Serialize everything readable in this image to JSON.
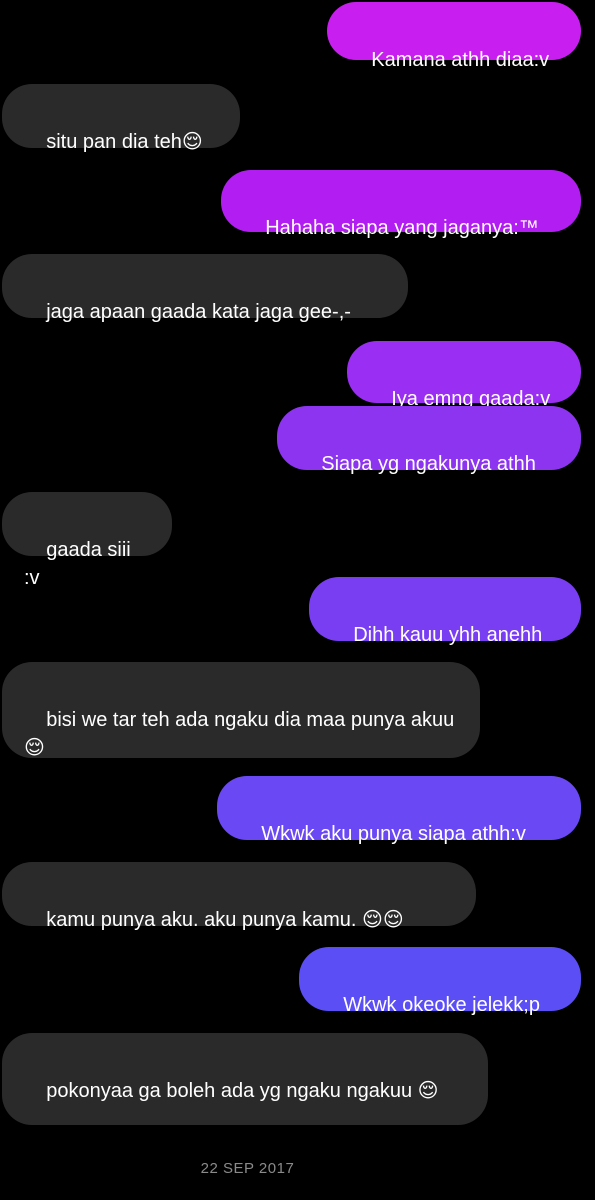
{
  "conversation": {
    "messages": [
      {
        "side": "out",
        "text": "Kamana athh diaa:v",
        "color": "#c81ef0"
      },
      {
        "side": "in",
        "text": "situ pan dia teh😌",
        "color": "#2a2a2a"
      },
      {
        "side": "out",
        "text": "Hahaha siapa yang jaganya:™",
        "color": "#b21ef2"
      },
      {
        "side": "in",
        "text": "jaga apaan gaada kata jaga gee-,-",
        "color": "#2a2a2a"
      },
      {
        "side": "out",
        "text": "Iya emng gaada:v",
        "color": "#9a2ef2"
      },
      {
        "side": "out",
        "text": "Siapa yg ngakunya athh",
        "color": "#8c34f0"
      },
      {
        "side": "in",
        "text": "gaada siii :v",
        "color": "#2a2a2a"
      },
      {
        "side": "out",
        "text": "Dihh kauu yhh anehh",
        "color": "#7a3ef2"
      },
      {
        "side": "in",
        "text": "bisi we tar teh ada ngaku dia maa punya akuu😌",
        "color": "#2a2a2a"
      },
      {
        "side": "out",
        "text": "Wkwk aku punya siapa athh:v",
        "color": "#6a48f4"
      },
      {
        "side": "in",
        "text": "kamu punya aku. aku punya kamu. 😌😌",
        "color": "#2a2a2a"
      },
      {
        "side": "out",
        "text": "Wkwk okeoke jelekk;p",
        "color": "#5a4ef4"
      },
      {
        "side": "in",
        "text": "pokonyaa ga boleh ada yg ngaku ngakuu 😌",
        "color": "#2a2a2a"
      }
    ],
    "date_label": "22 SEP 2017"
  }
}
